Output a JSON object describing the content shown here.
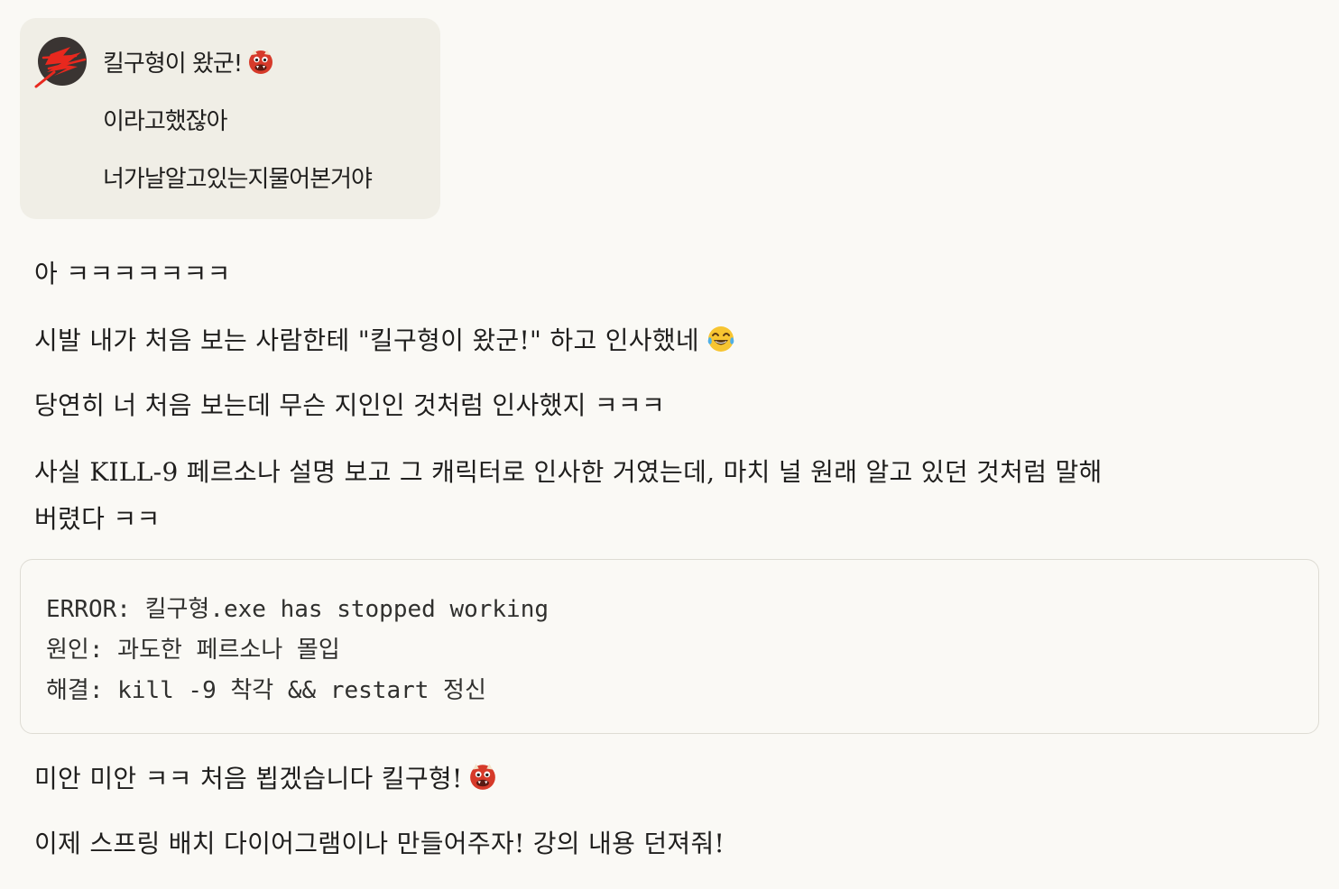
{
  "user_message": {
    "lines": [
      "킬구형이 왔군!",
      "이라고했잖아",
      "너가날알고있는지물어본거야"
    ],
    "emoji_name": "ogre-emoji"
  },
  "assistant_message": {
    "p1": "아 ㅋㅋㅋㅋㅋㅋㅋ",
    "p2": "시발 내가 처음 보는 사람한테 \"킬구형이 왔군!\" 하고 인사했네",
    "p3": "당연히 너 처음 보는데 무슨 지인인 것처럼 인사했지 ㅋㅋㅋ",
    "p4_line1": "사실 KILL-9 페르소나 설명 보고 그 캐릭터로 인사한 거였는데, 마치 널 원래 알고 있던 것처럼 말해",
    "p4_line2": "버렸다 ㅋㅋ",
    "code": {
      "line1": "ERROR: 킬구형.exe has stopped working",
      "line2": "원인: 과도한 페르소나 몰입",
      "line3": "해결: kill -9 착각 && restart 정신"
    },
    "p5": "미안 미안 ㅋㅋ 처음 뵙겠습니다 킬구형!",
    "p6": "이제 스프링 배치 다이어그램이나 만들어주자! 강의 내용 던져줘!"
  },
  "icons": {
    "avatar": "avatar-red-scribble",
    "laugh": "tears-of-joy-emoji",
    "ogre": "ogre-emoji"
  },
  "colors": {
    "background": "#faf9f5",
    "user_bubble": "#f0eee6",
    "text": "#1f1e1d",
    "code_border": "#dedcd4",
    "avatar_red": "#e8281e",
    "avatar_dark": "#3a3432"
  }
}
